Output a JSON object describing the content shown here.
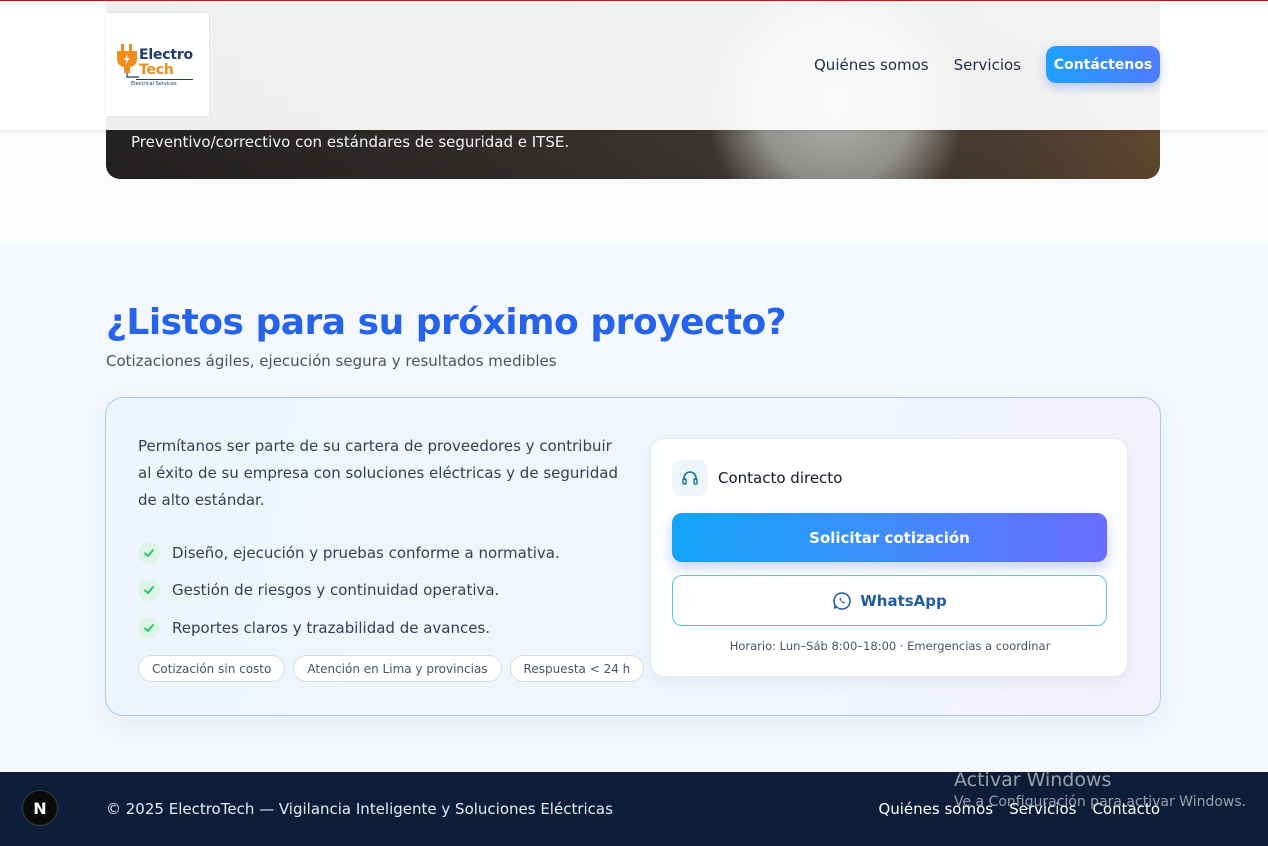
{
  "header": {
    "logo": {
      "line1": "Electro",
      "line2": "Tech",
      "tagline": "Electrical Services"
    },
    "nav": [
      {
        "label": "Quiénes somos"
      },
      {
        "label": "Servicios"
      }
    ],
    "cta_label": "Contáctenos"
  },
  "hero_card": {
    "text": "Preventivo/correctivo con estándares de seguridad e ITSE."
  },
  "section": {
    "title": "¿Listos para su próximo proyecto?",
    "subtitle": "Cotizaciones ágiles, ejecución segura y resultados medibles",
    "intro": "Permítanos ser parte de su cartera de proveedores y contribuir al éxito de su empresa con soluciones eléctricas y de seguridad de alto estándar.",
    "bullets": [
      "Diseño, ejecución y pruebas conforme a normativa.",
      "Gestión de riesgos y continuidad operativa.",
      "Reportes claros y trazabilidad de avances."
    ],
    "chips": [
      "Cotización sin costo",
      "Atención en Lima y provincias",
      "Respuesta < 24 h"
    ],
    "contact": {
      "title": "Contacto directo",
      "quote_label": "Solicitar cotización",
      "whatsapp_label": "WhatsApp",
      "hours": "Horario: Lun–Sáb 8:00–18:00 · Emergencias a coordinar"
    }
  },
  "footer": {
    "copyright": "© 2025 ElectroTech — Vigilancia Inteligente y Soluciones Eléctricas",
    "links": [
      "Quiénes somos",
      "Servicios",
      "Contacto"
    ]
  },
  "overlay": {
    "badge": "N",
    "watermark_title": "Activar Windows",
    "watermark_sub": "Ve a Configuración para activar Windows."
  },
  "colors": {
    "accent": "#2563eb",
    "footer_bg": "#0b1d38",
    "whatsapp_border": "#58c3ef",
    "check_green": "#22c55e"
  }
}
